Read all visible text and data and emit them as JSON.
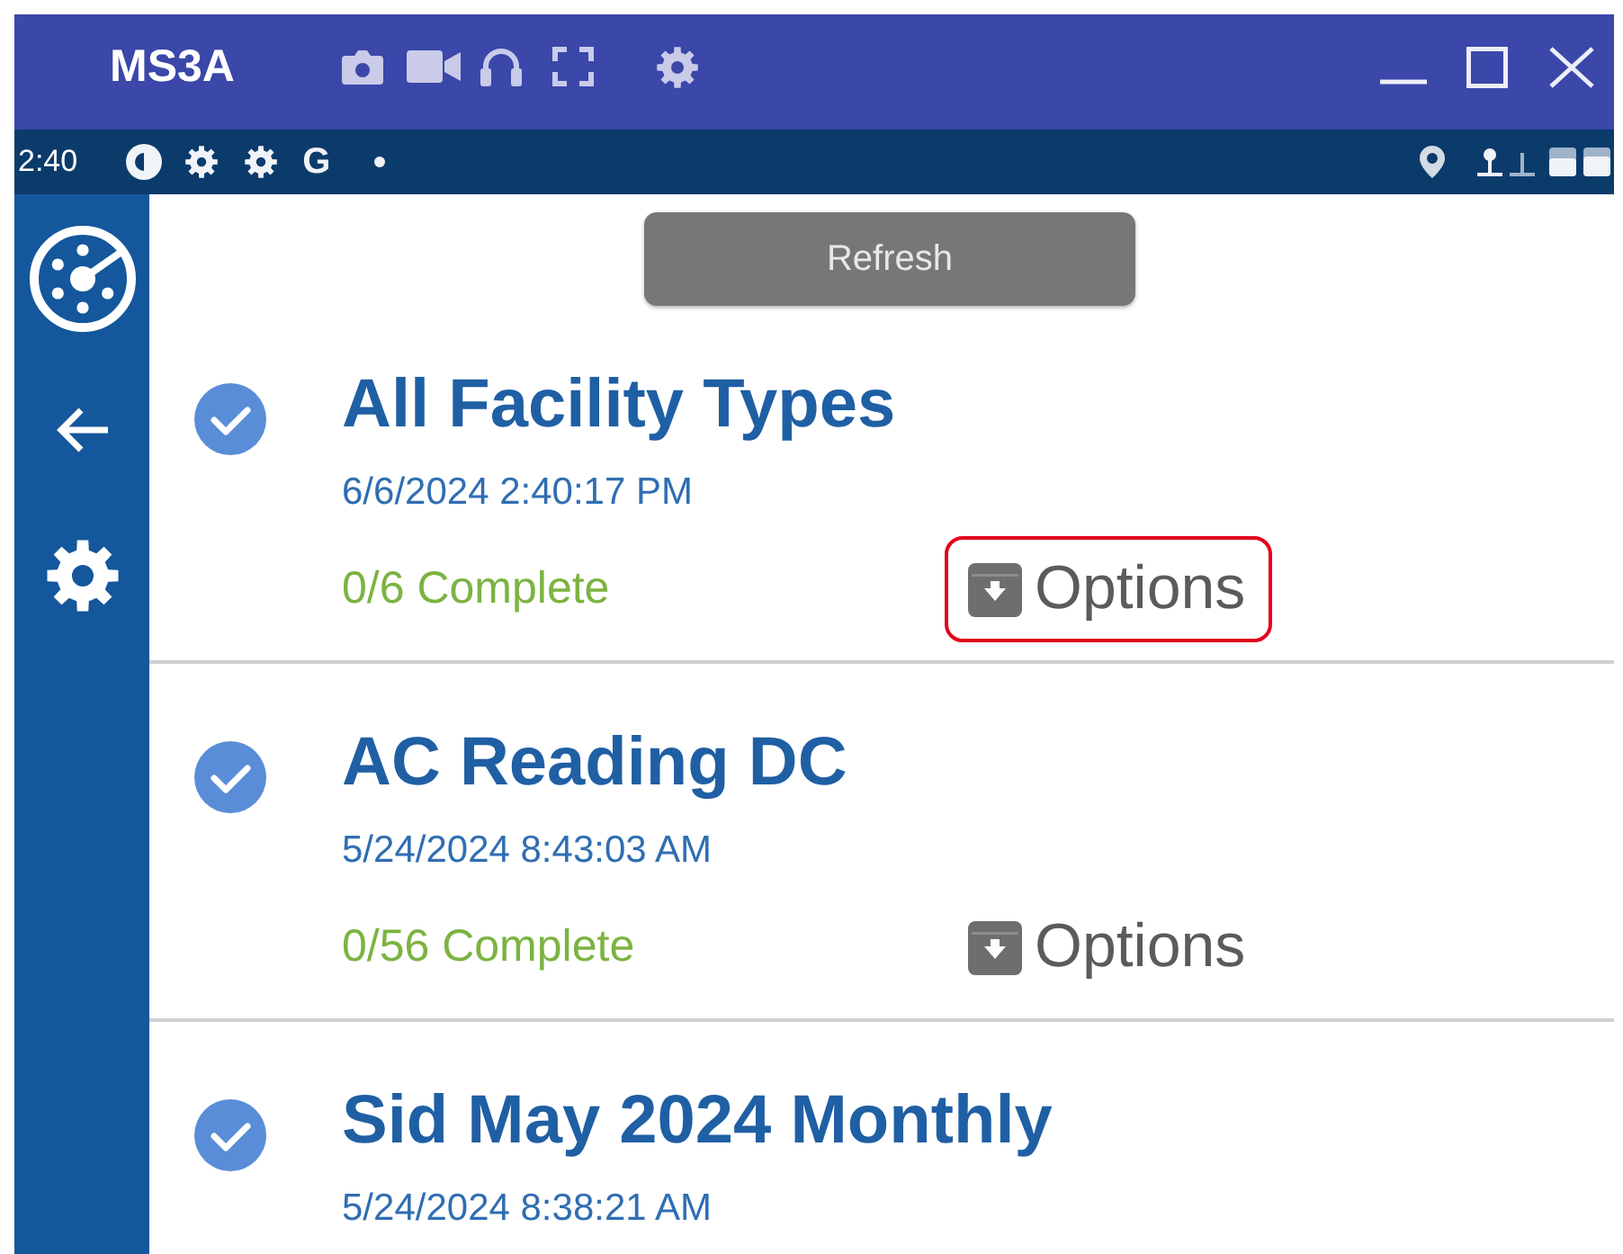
{
  "title_bar": {
    "title": "MS3A"
  },
  "status_bar": {
    "time": "2:40",
    "letter": "G"
  },
  "refresh_button": {
    "label": "Refresh"
  },
  "surveys": [
    {
      "title": "All Facility Types",
      "date": "6/6/2024 2:40:17 PM",
      "checked": true,
      "progress": "0/6 Complete",
      "options": {
        "label": "Options",
        "highlighted": true
      }
    },
    {
      "title": "AC Reading DC",
      "date": "5/24/2024 8:43:03 AM",
      "checked": true,
      "progress": "0/56 Complete",
      "options": {
        "label": "Options",
        "highlighted": false
      }
    },
    {
      "title": "Sid May 2024 Monthly",
      "date": "5/24/2024 8:38:21 AM",
      "checked": true
    }
  ]
}
